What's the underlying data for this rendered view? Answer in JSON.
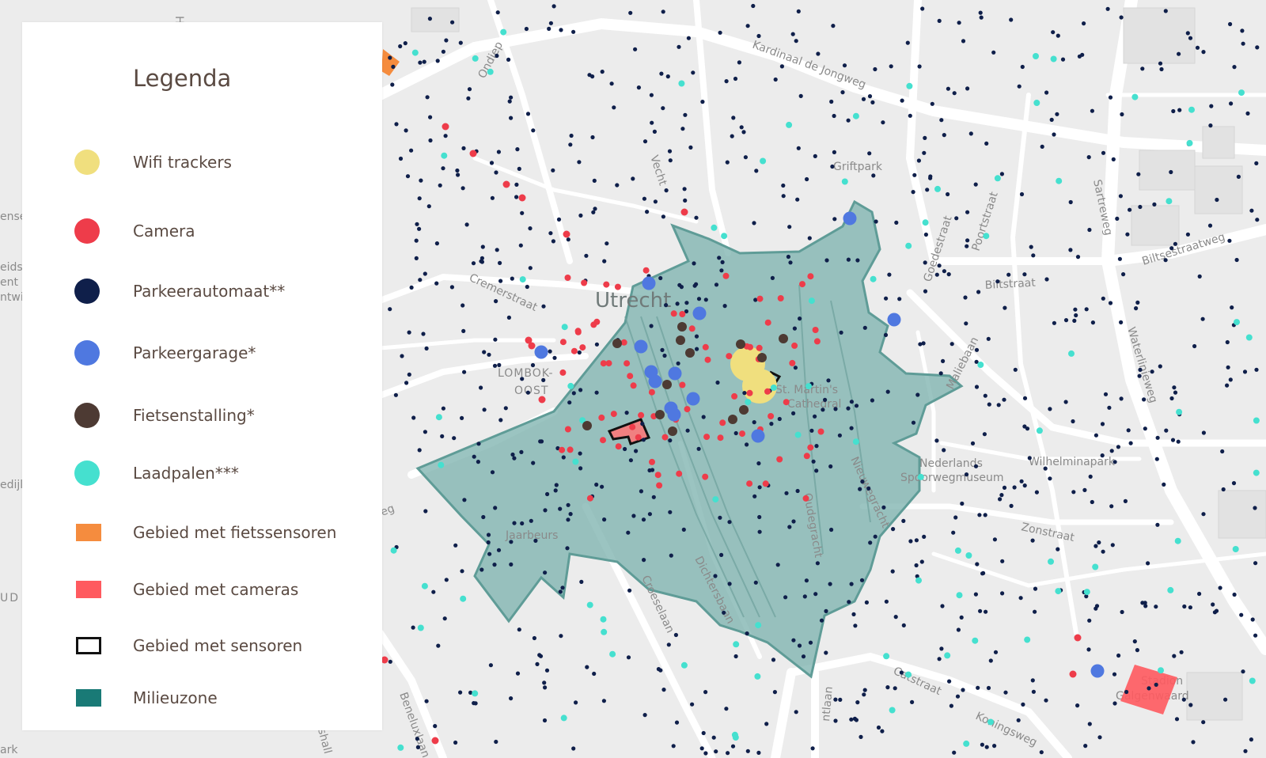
{
  "legend": {
    "title": "Legenda",
    "items": [
      {
        "label": "Wifi trackers",
        "color": "#f0df7e",
        "shape": "dot",
        "name": "wifi-trackers"
      },
      {
        "label": "Camera",
        "color": "#ee3c4a",
        "shape": "dot",
        "name": "camera"
      },
      {
        "label": "Parkeerautomaat**",
        "color": "#0f1f4a",
        "shape": "dot",
        "name": "parkeerautomaat"
      },
      {
        "label": "Parkeergarage*",
        "color": "#4f78e0",
        "shape": "dot",
        "name": "parkeergarage"
      },
      {
        "label": "Fietsenstalling*",
        "color": "#4d3a33",
        "shape": "dot",
        "name": "fietsenstalling"
      },
      {
        "label": "Laadpalen***",
        "color": "#45e0cf",
        "shape": "dot",
        "name": "laadpalen"
      },
      {
        "label": "Gebied met fietssensoren",
        "color": "#f58c3e",
        "shape": "square",
        "name": "fietssensoren-area"
      },
      {
        "label": "Gebied met cameras",
        "color": "#ff5a5f",
        "shape": "square",
        "name": "cameras-area"
      },
      {
        "label": "Gebied met sensoren",
        "color": "#111111",
        "shape": "outline",
        "name": "sensoren-area"
      },
      {
        "label": "Milieuzone",
        "color": "#197a76",
        "shape": "square",
        "name": "milieuzone"
      }
    ]
  },
  "map": {
    "city_label": "Utrecht",
    "labels": [
      "Kardinaal de Jongweg",
      "Ondiep",
      "Vecht",
      "Griftpark",
      "Sartreweg",
      "Biltsestraatweg",
      "Biltstraat",
      "Poortstraat",
      "Goedestraat",
      "Cremerstraat",
      "LOMBOK-",
      "OOST",
      "St. Martin's",
      "Cathedral",
      "Maliebaan",
      "Waterlinieweg",
      "Nederlands",
      "Spoorwegmuseum",
      "Wilhelminapark",
      "Jaarbeurs",
      "Oudegracht",
      "Nieuwegracht",
      "Dichtersbaan",
      "Croeselaan",
      "Zonstraat",
      "Catstraat",
      "Koningsweg",
      "Beneluxlaan",
      "Stadion",
      "Galgenwaard",
      "Ha",
      "ense",
      "eids",
      "ent",
      "ntwi",
      "edijl",
      "eg",
      "UD",
      "ark",
      "shall",
      "ntlaan"
    ],
    "colors": {
      "background": "#ececec",
      "road": "#ffffff",
      "zone_fill": "#7fb4b0",
      "zone_stroke": "#5f9c97"
    }
  }
}
